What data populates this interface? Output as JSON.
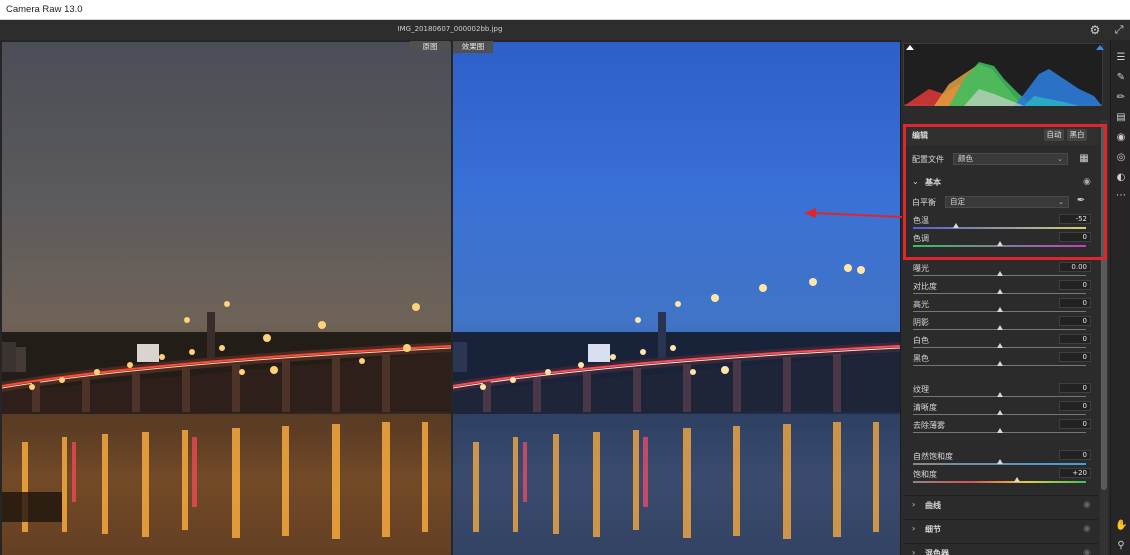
{
  "app": {
    "title": "Camera Raw 13.0"
  },
  "topbar": {
    "filename": "IMG_20180607_000002bb.jpg"
  },
  "view": {
    "before_label": "原图",
    "after_label": "效果图"
  },
  "panel": {
    "edit": {
      "title": "编辑",
      "auto_label": "自动",
      "bw_label": "黑白"
    },
    "profile": {
      "label": "配置文件",
      "value": "颜色"
    },
    "basic": {
      "title": "基本",
      "white_balance": {
        "label": "白平衡",
        "value": "自定"
      },
      "sliders_wb": [
        {
          "label": "色温",
          "value": "-52",
          "position": 0.25
        },
        {
          "label": "色调",
          "value": "0",
          "position": 0.5
        }
      ],
      "sliders": [
        {
          "label": "曝光",
          "value": "0.00",
          "position": 0.5
        },
        {
          "label": "对比度",
          "value": "0",
          "position": 0.5
        },
        {
          "label": "高光",
          "value": "0",
          "position": 0.5
        },
        {
          "label": "阴影",
          "value": "0",
          "position": 0.5
        },
        {
          "label": "白色",
          "value": "0",
          "position": 0.5
        },
        {
          "label": "黑色",
          "value": "0",
          "position": 0.5
        }
      ],
      "sliders_presence": [
        {
          "label": "纹理",
          "value": "0",
          "position": 0.5
        },
        {
          "label": "清晰度",
          "value": "0",
          "position": 0.5
        },
        {
          "label": "去除薄雾",
          "value": "0",
          "position": 0.5
        }
      ],
      "sliders_color": [
        {
          "label": "自然饱和度",
          "value": "0",
          "position": 0.5
        },
        {
          "label": "饱和度",
          "value": "+20",
          "position": 0.6
        }
      ]
    },
    "sections": [
      {
        "title": "曲线"
      },
      {
        "title": "细节"
      },
      {
        "title": "混色器"
      }
    ]
  },
  "colors": {
    "annotation": "#e0262d",
    "panel_bg": "#2b2b2b"
  }
}
